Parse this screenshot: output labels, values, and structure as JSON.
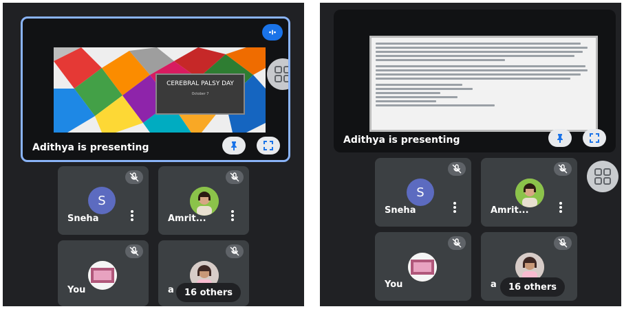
{
  "left": {
    "presenting_label": "Adithya is presenting",
    "slide": {
      "title": "CEREBRAL PALSY DAY",
      "date": "October 7"
    },
    "tiles": [
      {
        "name": "Sneha",
        "avatar_letter": "S"
      },
      {
        "name": "Amrit..."
      },
      {
        "name": "You"
      },
      {
        "name": "a",
        "others": "16 others"
      }
    ]
  },
  "right": {
    "presenting_label": "Adithya is presenting",
    "tiles": [
      {
        "name": "Sneha",
        "avatar_letter": "S"
      },
      {
        "name": "Amrit..."
      },
      {
        "name": "You"
      },
      {
        "name": "a",
        "others": "16 others"
      }
    ]
  },
  "icons": {
    "pin": "pin-icon",
    "fullscreen": "fullscreen-icon",
    "mic_off": "mic-off-icon",
    "grid": "grid-layout-icon",
    "audio": "audio-level-icon"
  },
  "colors": {
    "panel_bg": "#202124",
    "tile_bg": "#3c4043",
    "active_border": "#8ab4f8",
    "avatar": "#5c6bc0"
  }
}
